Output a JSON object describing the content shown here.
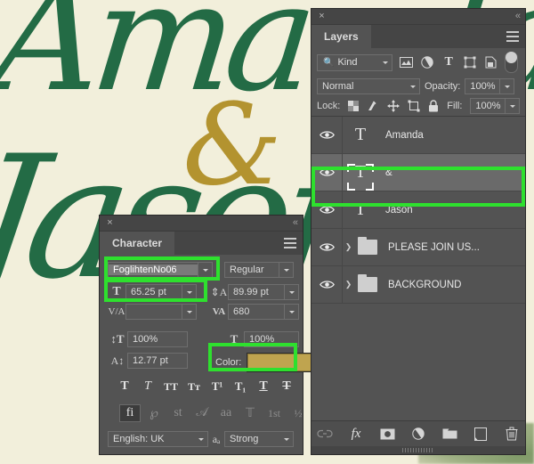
{
  "canvas": {
    "background_color": "#f2efdb",
    "script_color": "#236b45",
    "ampersand_color": "#b3932f",
    "word_top": "Amanda",
    "word_bottom": "Jason",
    "ampersand": "&"
  },
  "character_panel": {
    "title": "Character",
    "close_icon": "×",
    "collapse_icon": "«",
    "menu_icon": "hamburger-menu-icon",
    "font_family": "FoglihtenNo06",
    "font_style": "Regular",
    "font_size": "65.25 pt",
    "leading": "89.99 pt",
    "kerning": "",
    "tracking": "680",
    "vertical_scale": "100%",
    "horizontal_scale": "100%",
    "baseline_shift": "12.77 pt",
    "color_label": "Color:",
    "color_value": "#bfa44f",
    "labels": {
      "size_icon": "font-size-icon",
      "leading_icon": "leading-icon",
      "kerning_icon": "kerning-icon",
      "tracking_icon": "tracking-icon",
      "vscale_icon": "vertical-scale-icon",
      "hscale_icon": "horizontal-scale-icon",
      "baseline_icon": "baseline-shift-icon"
    },
    "faux_styles": [
      {
        "glyph": "T",
        "name": "faux-bold",
        "style": "bold"
      },
      {
        "glyph": "T",
        "name": "faux-italic",
        "style": "italic"
      },
      {
        "glyph": "TT",
        "name": "all-caps",
        "style": "caps"
      },
      {
        "glyph": "Tᴛ",
        "name": "small-caps",
        "style": "smallcaps"
      },
      {
        "glyph": "T¹",
        "name": "superscript",
        "style": "sup"
      },
      {
        "glyph": "T₁",
        "name": "subscript",
        "style": "sub"
      },
      {
        "glyph": "T",
        "name": "underline",
        "style": "underline"
      },
      {
        "glyph": "T",
        "name": "strikethrough",
        "style": "strike"
      }
    ],
    "opentype_styles": [
      {
        "glyph": "fi",
        "name": "standard-ligatures",
        "active": true
      },
      {
        "glyph": "℘",
        "name": "contextual-alternates",
        "active": false
      },
      {
        "glyph": "st",
        "name": "discretionary-ligatures",
        "active": false
      },
      {
        "glyph": "𝒜",
        "name": "swash",
        "active": false
      },
      {
        "glyph": "aa",
        "name": "oldstyle",
        "active": false
      },
      {
        "glyph": "𝕋",
        "name": "titling-alternates",
        "active": false
      },
      {
        "glyph": "1st",
        "name": "ordinals",
        "active": false
      },
      {
        "glyph": "½",
        "name": "fractions",
        "active": false
      }
    ],
    "language": "English: UK",
    "antialias_icon": "anti-alias-icon",
    "antialias": "Strong",
    "highlight_color": "#2ee02e"
  },
  "layers_panel": {
    "title": "Layers",
    "close_icon": "×",
    "collapse_icon": "«",
    "menu_icon": "hamburger-menu-icon",
    "filter_kind": "Kind",
    "filter_search_icon": "search-icon",
    "filter_icons": [
      {
        "name": "filter-pixel-layers-icon",
        "glyph": "image"
      },
      {
        "name": "filter-adjustment-layers-icon",
        "glyph": "halfcircle"
      },
      {
        "name": "filter-type-layers-icon",
        "glyph": "T"
      },
      {
        "name": "filter-shape-layers-icon",
        "glyph": "shape"
      },
      {
        "name": "filter-smart-object-icon",
        "glyph": "smart"
      }
    ],
    "filter_toggle": "filter-enable-toggle",
    "blend_mode": "Normal",
    "opacity_label": "Opacity:",
    "opacity_value": "100%",
    "lock_label": "Lock:",
    "lock_icons": [
      {
        "name": "lock-transparent-pixels-icon"
      },
      {
        "name": "lock-image-pixels-icon"
      },
      {
        "name": "lock-position-icon"
      },
      {
        "name": "lock-artboard-nesting-icon"
      },
      {
        "name": "lock-all-icon"
      }
    ],
    "fill_label": "Fill:",
    "fill_value": "100%",
    "layers": [
      {
        "name": "Amanda",
        "type": "text",
        "visible": true,
        "selected": false
      },
      {
        "name": "&",
        "type": "text",
        "visible": true,
        "selected": true
      },
      {
        "name": "Jason",
        "type": "text",
        "visible": true,
        "selected": false
      },
      {
        "name": "PLEASE JOIN US...",
        "type": "group",
        "visible": true,
        "selected": false
      },
      {
        "name": "BACKGROUND",
        "type": "group",
        "visible": true,
        "selected": false
      }
    ],
    "bottom_icons": [
      {
        "name": "link-layers-icon",
        "disabled": true
      },
      {
        "name": "layer-style-fx-icon",
        "disabled": false
      },
      {
        "name": "add-layer-mask-icon",
        "disabled": false
      },
      {
        "name": "new-adjustment-layer-icon",
        "disabled": false
      },
      {
        "name": "new-group-icon",
        "disabled": false
      },
      {
        "name": "new-layer-icon",
        "disabled": false
      },
      {
        "name": "delete-layer-icon",
        "disabled": false
      }
    ],
    "highlight_color": "#2ee02e"
  }
}
